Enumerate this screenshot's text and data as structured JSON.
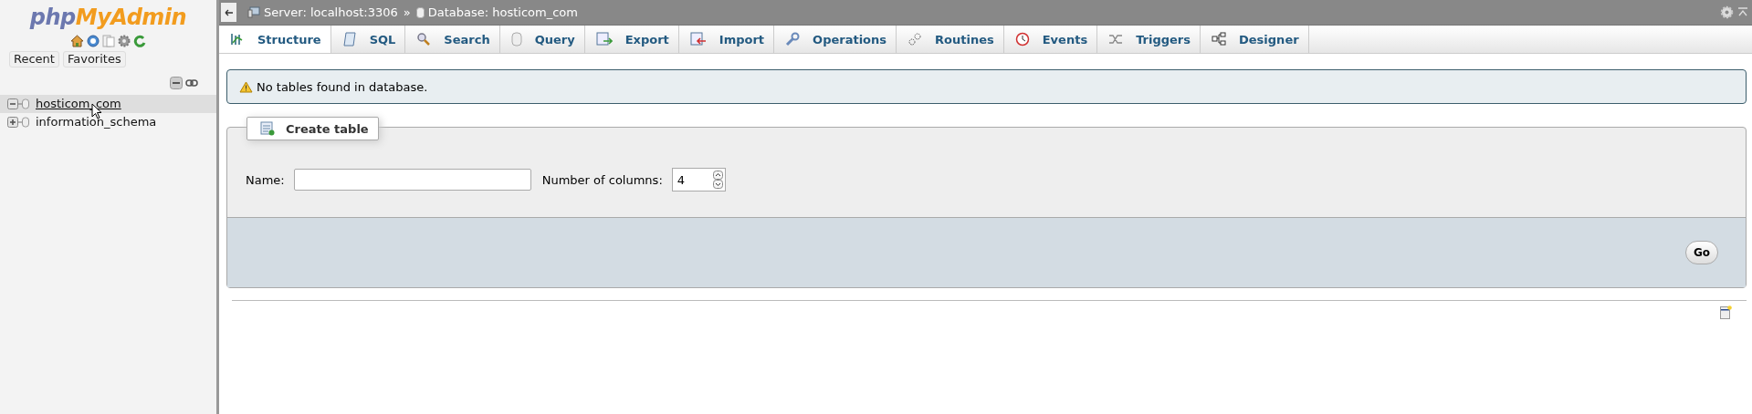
{
  "sidebar": {
    "logo": {
      "part_1": "php",
      "part_2": "MyAdmin"
    },
    "tabs": [
      {
        "label": "Recent",
        "selected": false
      },
      {
        "label": "Favorites",
        "selected": false
      }
    ],
    "databases": [
      {
        "name": "hosticom_com",
        "expanded": true,
        "selected": true
      },
      {
        "name": "information_schema",
        "expanded": false,
        "selected": false
      }
    ]
  },
  "breadcrumb": [
    {
      "kind": "server",
      "label": "Server: localhost:3306"
    },
    {
      "kind": "separator",
      "label": "»"
    },
    {
      "kind": "database",
      "label": "Database: hosticom_com"
    }
  ],
  "tabs": [
    {
      "label": "Structure",
      "kind": "structure",
      "selected": true
    },
    {
      "label": "SQL",
      "kind": "sql",
      "selected": false
    },
    {
      "label": "Search",
      "kind": "search",
      "selected": false
    },
    {
      "label": "Query",
      "kind": "query",
      "selected": false
    },
    {
      "label": "Export",
      "kind": "export",
      "selected": false
    },
    {
      "label": "Import",
      "kind": "import",
      "selected": false
    },
    {
      "label": "Operations",
      "kind": "operations",
      "selected": false
    },
    {
      "label": "Routines",
      "kind": "routines",
      "selected": false
    },
    {
      "label": "Events",
      "kind": "events",
      "selected": false
    },
    {
      "label": "Triggers",
      "kind": "triggers",
      "selected": false
    },
    {
      "label": "Designer",
      "kind": "designer",
      "selected": false
    }
  ],
  "notice": "No tables found in database.",
  "create_table": {
    "legend": "Create table",
    "name_label": "Name:",
    "columns_label": "Number of columns:",
    "columns_value": "4",
    "go": "Go"
  }
}
